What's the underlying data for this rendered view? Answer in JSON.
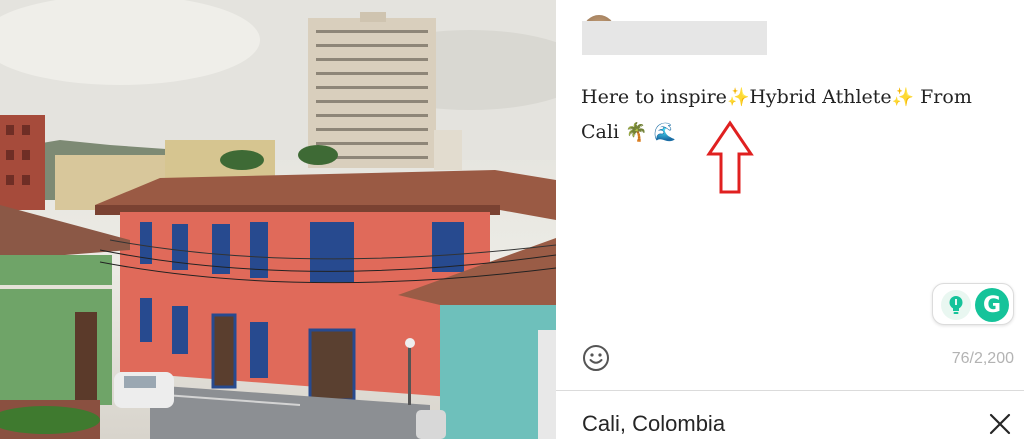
{
  "post": {
    "caption": {
      "part1": "Here to inspire",
      "sparkle": "✨",
      "part2": "Hybrid Athlete",
      "part3": " From Cali",
      "palm": "🌴",
      "wave": "🌊"
    },
    "char_count": "76/2,200",
    "location": "Cali, Colombia"
  },
  "icons": {
    "emoji_picker": "smiley-icon",
    "grammarly_suggestion": "lightbulb-icon",
    "grammarly_logo": "G",
    "close": "close-icon",
    "annotation": "red-up-arrow"
  },
  "colors": {
    "grammarly_green": "#15c39a",
    "annotation_red": "#e02020",
    "counter_gray": "#b3b3b3"
  }
}
